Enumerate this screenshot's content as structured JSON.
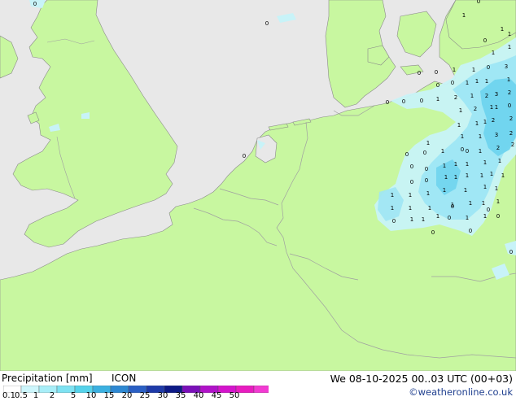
{
  "legend": {
    "title": "Precipitation [mm]",
    "model": "ICON",
    "ticks": [
      "0.1",
      "0.5",
      "1",
      "2",
      "5",
      "10",
      "15",
      "20",
      "25",
      "30",
      "35",
      "40",
      "45",
      "50"
    ],
    "colors": [
      "#ffffff",
      "#cdf6fc",
      "#a8eef8",
      "#7ee2f2",
      "#55d2ea",
      "#3bb0e0",
      "#2e88d2",
      "#2a5fc4",
      "#1e3aa8",
      "#0d1a86",
      "#7a10b8",
      "#b012c8",
      "#d414cc",
      "#e81cc0",
      "#f23ad2"
    ]
  },
  "valid_time": "We 08-10-2025 00..03 UTC (00+03)",
  "credit": "©weatheronline.co.uk",
  "map_colors": {
    "land": "#c8f7a0",
    "sea": "#e8e8e8",
    "border": "#a0a0a0",
    "precip_light": "#c8f3f8",
    "precip_mid": "#9ee6f4",
    "precip_heavy": "#6fd4ee"
  },
  "precip_values": [
    "0",
    "1",
    "0",
    "0",
    "1",
    "1",
    "1",
    "0",
    "1",
    "1",
    "1",
    "0",
    "3",
    "0",
    "0",
    "0",
    "0",
    "1",
    "1",
    "1",
    "1",
    "3",
    "0",
    "0",
    "0",
    "2",
    "1",
    "2",
    "2",
    "1",
    "0",
    "1",
    "2",
    "1",
    "1",
    "2",
    "1",
    "1",
    "1",
    "2",
    "2",
    "3",
    "1",
    "0",
    "2",
    "2",
    "1",
    "1",
    "0",
    "0",
    "1",
    "0",
    "1",
    "1",
    "1",
    "1",
    "0",
    "0",
    "1",
    "1",
    "1",
    "1",
    "1",
    "1",
    "1",
    "1",
    "1",
    "1",
    "1",
    "1",
    "1",
    "1",
    "0",
    "1",
    "1",
    "1",
    "1",
    "1",
    "0",
    "1",
    "1",
    "0",
    "1",
    "0",
    "1",
    "1",
    "0",
    "0",
    "0",
    "1",
    "1",
    "0",
    "0",
    "1",
    "0",
    "0"
  ]
}
